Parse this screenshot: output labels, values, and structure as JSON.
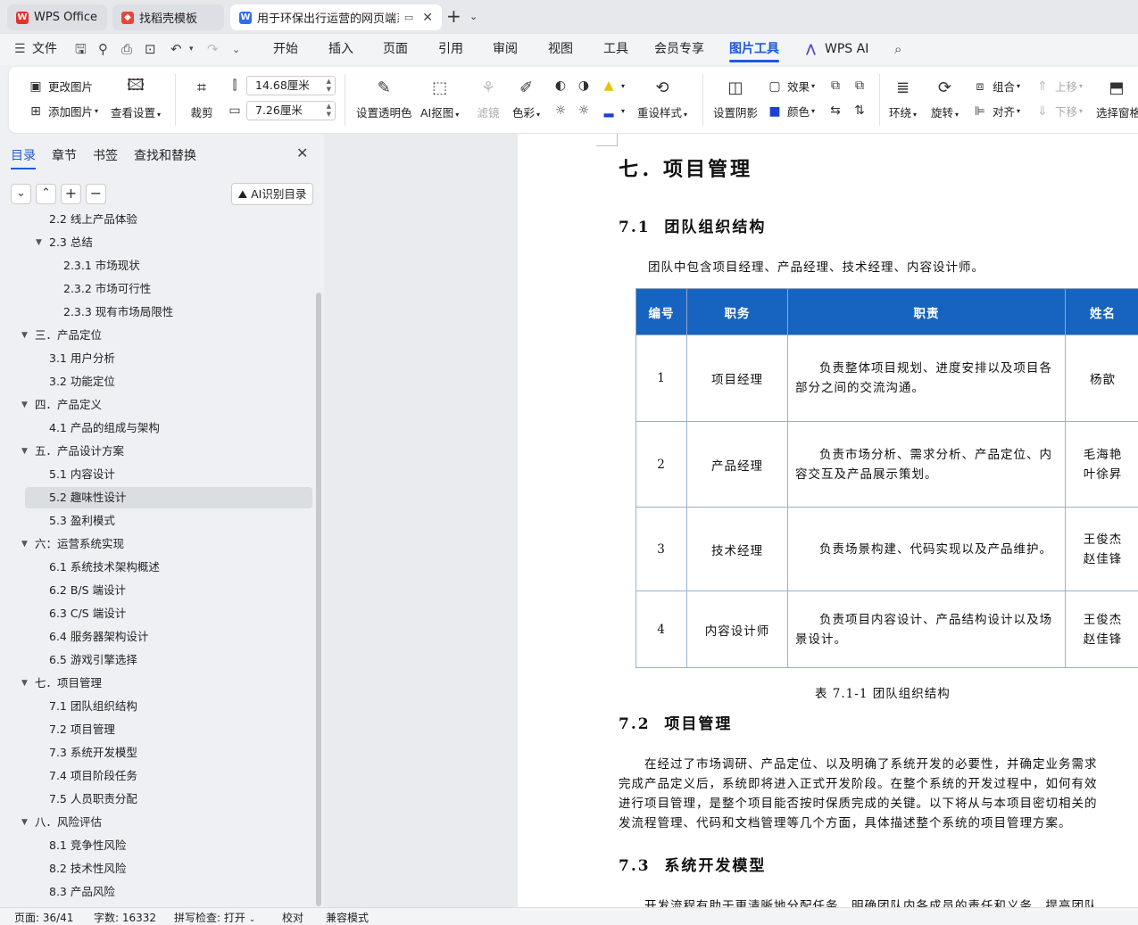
{
  "tabs": [
    {
      "label": "WPS Office",
      "icon": "wps-logo-icon"
    },
    {
      "label": "找稻壳模板",
      "icon": "docer-icon"
    },
    {
      "label": "用于环保出行运营的网页端系",
      "icon": "word-doc-icon"
    }
  ],
  "menu": {
    "file": "文件",
    "items": [
      "开始",
      "插入",
      "页面",
      "引用",
      "审阅",
      "视图",
      "工具",
      "会员专享",
      "图片工具",
      "WPS AI"
    ]
  },
  "ribbon": {
    "change_image": "更改图片",
    "add_image": "添加图片",
    "view_settings": "查看设置",
    "crop": "裁剪",
    "width_value": "14.68厘米",
    "height_value": "7.26厘米",
    "set_transparent": "设置透明色",
    "ai_cutout": "AI抠图",
    "filter": "滤镜",
    "color": "色彩",
    "reset_style": "重设样式",
    "set_shadow": "设置阴影",
    "effect": "效果",
    "color2": "颜色",
    "wrap": "环绕",
    "rotate": "旋转",
    "group": "组合",
    "align": "对齐",
    "move_up": "上移",
    "move_down": "下移",
    "selection_pane": "选择窗格"
  },
  "sidebar": {
    "tabs": [
      "目录",
      "章节",
      "书签",
      "查找和替换"
    ],
    "ai_button": "AI识别目录",
    "toc": [
      {
        "label": "2.2  线上产品体验",
        "level": 2
      },
      {
        "label": "2.3  总结",
        "level": 2,
        "expanded": true
      },
      {
        "label": "2.3.1  市场现状",
        "level": 3
      },
      {
        "label": "2.3.2  市场可行性",
        "level": 3
      },
      {
        "label": "2.3.3  现有市场局限性",
        "level": 3
      },
      {
        "label": "三．产品定位",
        "level": 1,
        "expanded": true
      },
      {
        "label": "3.1  用户分析",
        "level": 2
      },
      {
        "label": "3.2  功能定位",
        "level": 2
      },
      {
        "label": "四．产品定义",
        "level": 1,
        "expanded": true
      },
      {
        "label": "4.1  产品的组成与架构",
        "level": 2
      },
      {
        "label": "五．产品设计方案",
        "level": 1,
        "expanded": true
      },
      {
        "label": "5.1 内容设计",
        "level": 2
      },
      {
        "label": "5.2  趣味性设计",
        "level": 2,
        "selected": true
      },
      {
        "label": "5.3  盈利模式",
        "level": 2
      },
      {
        "label": "六：运营系统实现",
        "level": 1,
        "expanded": true
      },
      {
        "label": "6.1  系统技术架构概述",
        "level": 2
      },
      {
        "label": "6.2 B/S 端设计",
        "level": 2
      },
      {
        "label": "6.3 C/S 端设计",
        "level": 2
      },
      {
        "label": "6.4 服务器架构设计",
        "level": 2
      },
      {
        "label": "6.5 游戏引擎选择",
        "level": 2
      },
      {
        "label": "七．项目管理",
        "level": 1,
        "expanded": true
      },
      {
        "label": "7.1  团队组织结构",
        "level": 2
      },
      {
        "label": "7.2  项目管理",
        "level": 2
      },
      {
        "label": "7.3  系统开发模型",
        "level": 2
      },
      {
        "label": "7.4  项目阶段任务",
        "level": 2
      },
      {
        "label": "7.5  人员职责分配",
        "level": 2
      },
      {
        "label": "八．风险评估",
        "level": 1,
        "expanded": true
      },
      {
        "label": "8.1  竞争性风险",
        "level": 2
      },
      {
        "label": "8.2  技术性风险",
        "level": 2
      },
      {
        "label": "8.3  产品风险",
        "level": 2
      }
    ]
  },
  "document": {
    "heading": "七．项目管理",
    "s71": {
      "num": "7.1",
      "title": "团队组织结构"
    },
    "intro": "团队中包含项目经理、产品经理、技术经理、内容设计师。",
    "table": {
      "headers": [
        "编号",
        "职务",
        "职责",
        "姓名"
      ],
      "rows": [
        {
          "no": "1",
          "role": "项目经理",
          "duty": "负责整体项目规划、进度安排以及项目各部分之间的交流沟通。",
          "names": [
            "杨歆"
          ]
        },
        {
          "no": "2",
          "role": "产品经理",
          "duty": "负责市场分析、需求分析、产品定位、内容交互及产品展示策划。",
          "names": [
            "毛海艳",
            "叶徐昇"
          ]
        },
        {
          "no": "3",
          "role": "技术经理",
          "duty": "负责场景构建、代码实现以及产品维护。",
          "names": [
            "王俊杰",
            "赵佳锋"
          ]
        },
        {
          "no": "4",
          "role": "内容设计师",
          "duty": "负责项目内容设计、产品结构设计以及场景设计。",
          "names": [
            "王俊杰",
            "赵佳锋"
          ]
        }
      ],
      "caption": "表 7.1-1    团队组织结构"
    },
    "s72": {
      "num": "7.2",
      "title": "项目管理"
    },
    "p72": [
      "　　在经过了市场调研、产品定位、以及明确了系统开发的必要性，并确定业务需求",
      "完成产品定义后，系统即将进入正式开发阶段。在整个系统的开发过程中，如何有效",
      "进行项目管理，是整个项目能否按时保质完成的关键。以下将从与本项目密切相关的",
      "发流程管理、代码和文档管理等几个方面，具体描述整个系统的项目管理方案。"
    ],
    "s73": {
      "num": "7.3",
      "title": "系统开发模型"
    },
    "p73": "　　开发流程有助于更清晰地分配任务，明确团队内各成员的责任和义务，提高团队"
  },
  "status": {
    "page": "页面: 36/41",
    "words": "字数: 16332",
    "spell": "拼写检查: 打开",
    "proof": "校对",
    "compat": "兼容模式"
  },
  "colors": {
    "accent": "#1d5bd8",
    "table_header": "#1764c0"
  }
}
